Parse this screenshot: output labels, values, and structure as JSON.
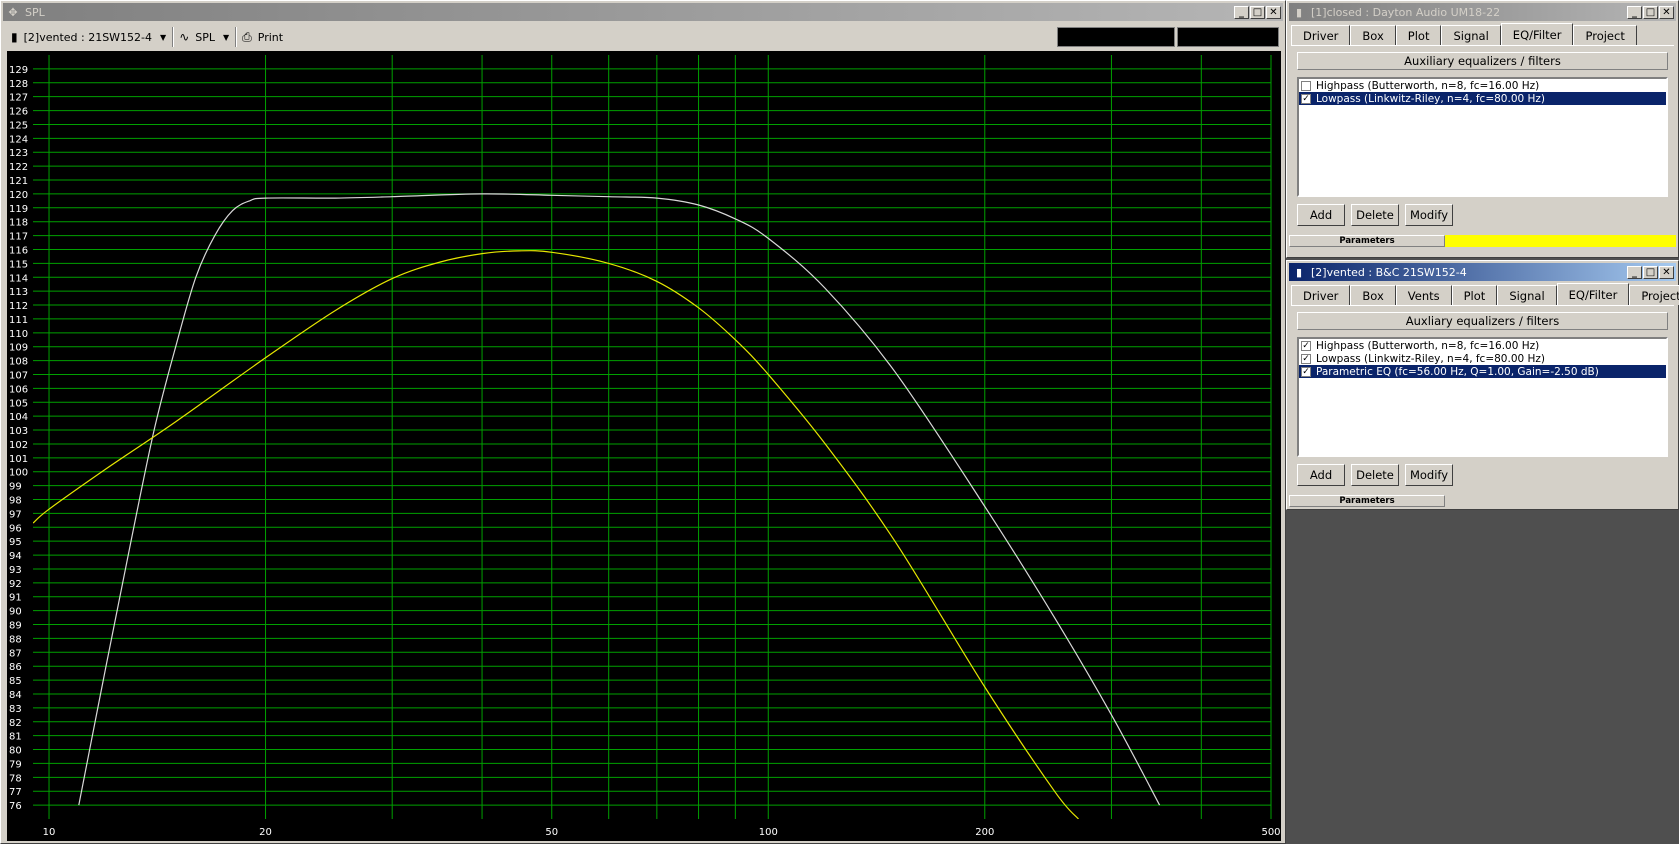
{
  "spl_window": {
    "title": "SPL",
    "toolbar": {
      "project_select": "[2]vented : 21SW152-4",
      "view_select": "SPL",
      "print_label": "Print"
    }
  },
  "chart_data": {
    "type": "line",
    "xscale": "log",
    "xlim": [
      9.5,
      500
    ],
    "ylim": [
      75,
      130
    ],
    "x_tick_labels": [
      "10",
      "20",
      "50",
      "100",
      "200",
      "500"
    ],
    "x_ticks": [
      10,
      20,
      50,
      100,
      200,
      500
    ],
    "y_ticks_from": 76,
    "y_ticks_to": 129,
    "grid": true,
    "background": "#000000",
    "grid_color": "#00a000",
    "series": [
      {
        "color": "#d8d8d8",
        "x": [
          11,
          12,
          13,
          14,
          15,
          16,
          17,
          18,
          19,
          20,
          25,
          30,
          40,
          50,
          60,
          70,
          80,
          90,
          100,
          120,
          150,
          200,
          250,
          300,
          350
        ],
        "y": [
          76,
          86,
          95,
          103,
          109,
          114,
          117,
          118.8,
          119.5,
          119.7,
          119.7,
          119.8,
          120,
          119.9,
          119.8,
          119.7,
          119.2,
          118.2,
          116.8,
          113.2,
          107.2,
          97.5,
          89.5,
          82.5,
          76
        ]
      },
      {
        "color": "#e6e600",
        "x": [
          9.5,
          10,
          12,
          15,
          20,
          25,
          30,
          35,
          40,
          45,
          50,
          60,
          70,
          80,
          90,
          100,
          120,
          150,
          200,
          250,
          270
        ],
        "y": [
          96.3,
          97.3,
          100.2,
          103.6,
          108.2,
          111.6,
          113.9,
          115.1,
          115.7,
          115.9,
          115.8,
          115,
          113.7,
          111.8,
          109.5,
          107,
          102,
          95,
          84.5,
          77,
          75
        ]
      }
    ]
  },
  "closed_window": {
    "title": "[1]closed : Dayton Audio UM18-22",
    "tabs": [
      "Driver",
      "Box",
      "Plot",
      "Signal",
      "EQ/Filter",
      "Project"
    ],
    "selected_tab": "EQ/Filter",
    "group_header": "Auxiliary equalizers / filters",
    "filters": [
      {
        "label": "Highpass (Butterworth, n=8, fc=16.00 Hz)",
        "checked": false,
        "selected": false
      },
      {
        "label": "Lowpass (Linkwitz-Riley, n=4, fc=80.00 Hz)",
        "checked": true,
        "selected": true
      }
    ],
    "buttons": {
      "add": "Add",
      "delete": "Delete",
      "modify": "Modify"
    },
    "params_label": "Parameters",
    "params_color": "#ffff00"
  },
  "vented_window": {
    "title": "[2]vented : B&C 21SW152-4",
    "tabs": [
      "Driver",
      "Box",
      "Vents",
      "Plot",
      "Signal",
      "EQ/Filter",
      "Project"
    ],
    "selected_tab": "EQ/Filter",
    "group_header": "Auxliary equalizers / filters",
    "filters": [
      {
        "label": "Highpass (Butterworth, n=8, fc=16.00 Hz)",
        "checked": true,
        "selected": false
      },
      {
        "label": "Lowpass (Linkwitz-Riley, n=4, fc=80.00 Hz)",
        "checked": true,
        "selected": false
      },
      {
        "label": "Parametric EQ (fc=56.00 Hz, Q=1.00, Gain=-2.50 dB)",
        "checked": true,
        "selected": true
      }
    ],
    "buttons": {
      "add": "Add",
      "delete": "Delete",
      "modify": "Modify"
    },
    "params_label": "Parameters",
    "params_color": "#d4d0c8"
  }
}
